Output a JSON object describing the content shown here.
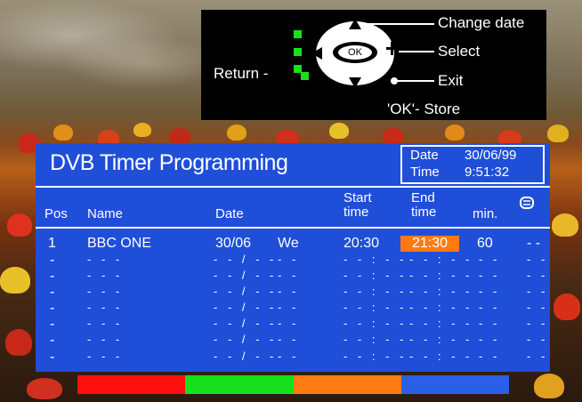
{
  "help": {
    "change_date": "Change date",
    "select": "Select",
    "exit": "Exit",
    "return_label": "Return -",
    "ok_button": "OK",
    "ok_store": "'OK'-  Store"
  },
  "panel": {
    "title": "DVB Timer Programming",
    "date_label": "Date",
    "date_value": "30/06/99",
    "time_label": "Time",
    "time_value": "9:51:32"
  },
  "columns": {
    "pos": "Pos",
    "name": "Name",
    "date": "Date",
    "start_1": "Start",
    "start_2": "time",
    "end_1": "End",
    "end_2": "time",
    "min": "min."
  },
  "rows": [
    {
      "pos": "1",
      "name": "BBC ONE",
      "date": "30/06",
      "day": "We",
      "start": "20:30",
      "end": "21:30",
      "min": "60",
      "extra": "- -"
    },
    {
      "pos": "-",
      "name": "- - -",
      "date": "- - / - -",
      "day": "- -",
      "start": "- - : - -",
      "end": "- - : - -",
      "min": "- -",
      "extra": "- -"
    },
    {
      "pos": "-",
      "name": "- - -",
      "date": "- - / - -",
      "day": "- -",
      "start": "- - : - -",
      "end": "- - : - -",
      "min": "- -",
      "extra": "- -"
    },
    {
      "pos": "-",
      "name": "- - -",
      "date": "- - / - -",
      "day": "- -",
      "start": "- - : - -",
      "end": "- - : - -",
      "min": "- -",
      "extra": "- -"
    },
    {
      "pos": "-",
      "name": "- - -",
      "date": "- - / - -",
      "day": "- -",
      "start": "- - : - -",
      "end": "- - : - -",
      "min": "- -",
      "extra": "- -"
    },
    {
      "pos": "-",
      "name": "- - -",
      "date": "- - / - -",
      "day": "- -",
      "start": "- - : - -",
      "end": "- - : - -",
      "min": "- -",
      "extra": "- -"
    },
    {
      "pos": "-",
      "name": "- - -",
      "date": "- - / - -",
      "day": "- -",
      "start": "- - : - -",
      "end": "- - : - -",
      "min": "- -",
      "extra": "- -"
    },
    {
      "pos": "-",
      "name": "- - -",
      "date": "- - / - -",
      "day": "- -",
      "start": "- - : - -",
      "end": "- - : - -",
      "min": "- -",
      "extra": "- -"
    }
  ],
  "colors": {
    "panel": "#1f4fd8",
    "highlight": "#ff7b12",
    "keys": [
      "#ff0f0f",
      "#14e01c",
      "#ff7b12",
      "#2a5fe8"
    ]
  }
}
